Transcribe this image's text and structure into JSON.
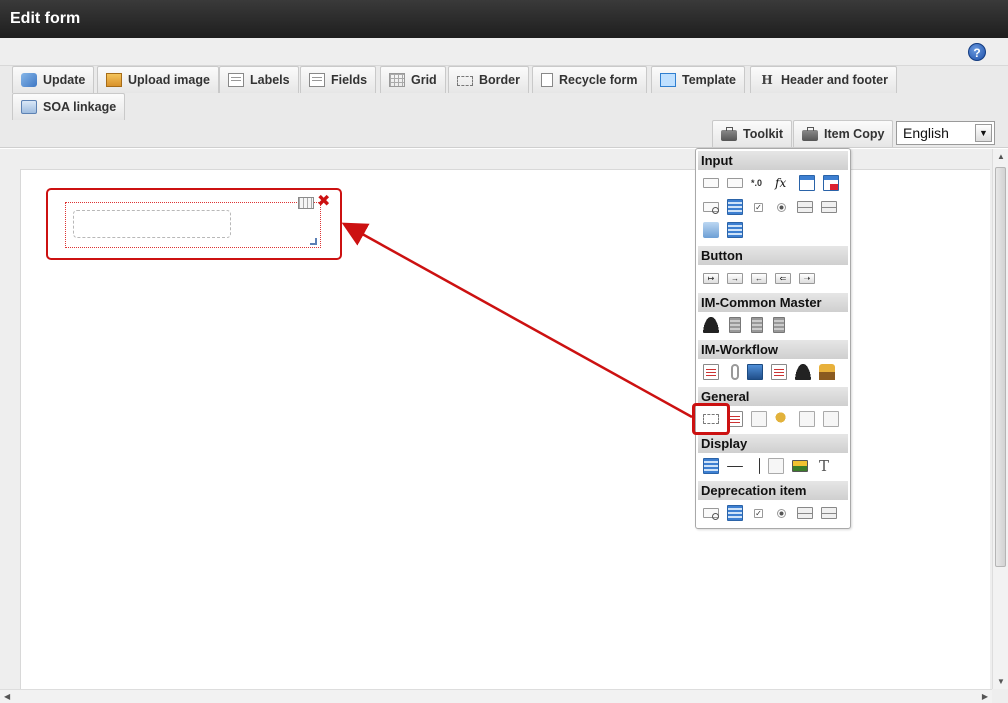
{
  "window": {
    "title": "Edit form"
  },
  "help": {
    "icon": "help-icon",
    "glyph": "?"
  },
  "toolbar": {
    "tabs_row1": [
      {
        "label": "Update",
        "icon": "update-icon"
      },
      {
        "label": "Upload image",
        "icon": "upload-image-icon"
      },
      {
        "label": "Labels",
        "icon": "labels-icon"
      },
      {
        "label": "Fields",
        "icon": "fields-icon"
      },
      {
        "label": "Grid",
        "icon": "grid-icon"
      },
      {
        "label": "Border",
        "icon": "border-icon"
      },
      {
        "label": "Recycle form",
        "icon": "recycle-form-icon"
      },
      {
        "label": "Template",
        "icon": "template-icon"
      },
      {
        "label": "Header and footer",
        "icon": "header-footer-icon"
      }
    ],
    "tabs_row2": [
      {
        "label": "SOA linkage",
        "icon": "soa-linkage-icon"
      }
    ],
    "tabs_row3": [
      {
        "label": "Toolkit",
        "icon": "toolkit-icon"
      },
      {
        "label": "Item Copy",
        "icon": "item-copy-icon"
      }
    ],
    "language": {
      "selected": "English",
      "arrow": "▼"
    }
  },
  "canvas": {
    "field": {
      "close_glyph": "✖"
    }
  },
  "palette": {
    "sections": [
      {
        "title": "Input"
      },
      {
        "title": "Button"
      },
      {
        "title": "IM-Common Master"
      },
      {
        "title": "IM-Workflow"
      },
      {
        "title": "General"
      },
      {
        "title": "Display"
      },
      {
        "title": "Deprecation item"
      }
    ],
    "calc_glyph": "*.0\n.00",
    "fx_glyph": "fx",
    "text_glyph": "T"
  },
  "colors": {
    "highlight": "#cc1111",
    "titlebar": "#2a2a2a",
    "accent": "#3d7fd1"
  }
}
